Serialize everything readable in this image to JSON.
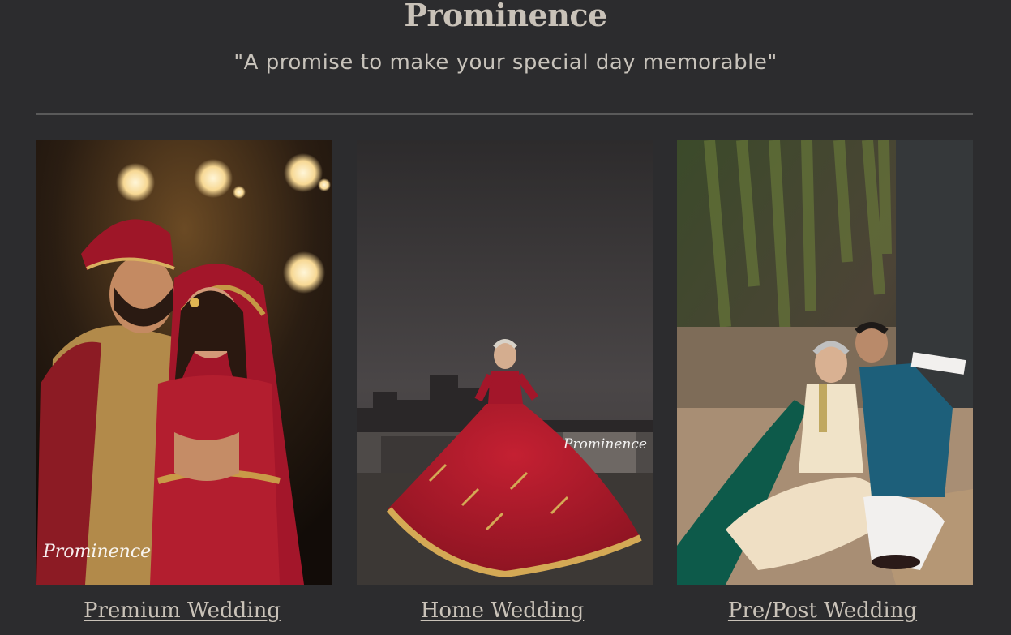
{
  "header": {
    "title": "Prominence",
    "tagline": "\"A promise to make your special day memorable\""
  },
  "cards": [
    {
      "label": "Premium Wedding",
      "photo_icon": "couple-portrait-photo",
      "watermark": "Prominence"
    },
    {
      "label": "Home Wedding",
      "photo_icon": "bride-twirl-photo",
      "watermark": "Prominence"
    },
    {
      "label": "Pre/Post Wedding",
      "photo_icon": "couple-seated-photo",
      "watermark": ""
    }
  ],
  "colors": {
    "background": "#2c2c2e",
    "title": "#c9c2b8",
    "divider": "#5a5a5a",
    "bridal_red": "#a3162a"
  }
}
